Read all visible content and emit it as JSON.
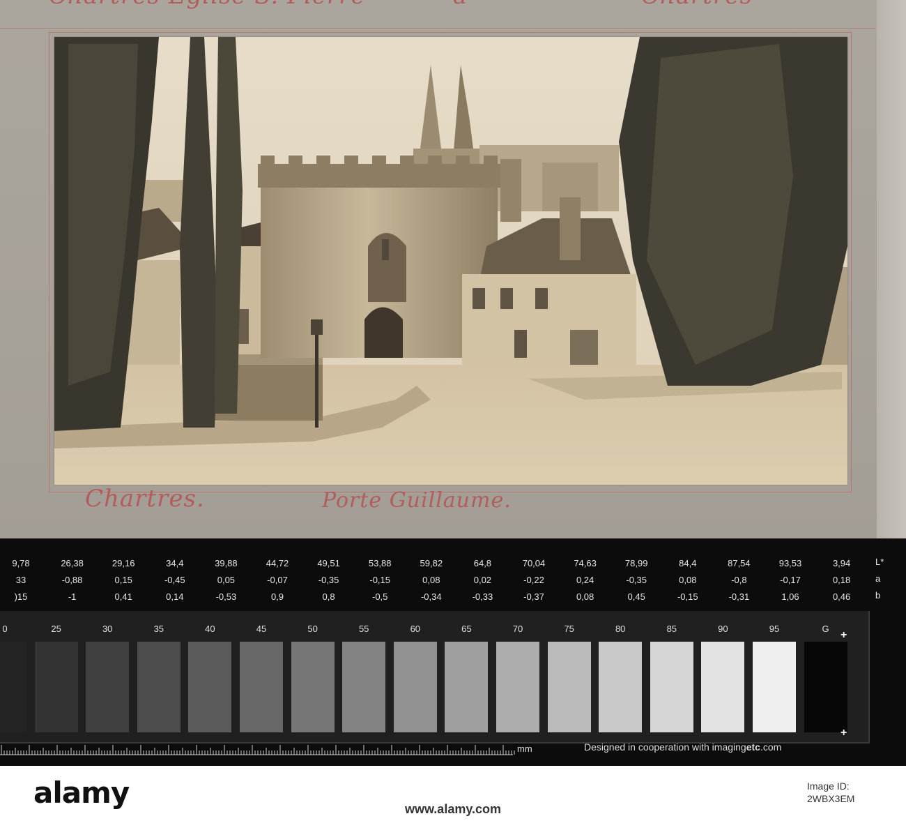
{
  "album": {
    "top_script": [
      "Chartres Église S. Pierre",
      "à",
      "Chartres"
    ],
    "caption_city": "Chartres.",
    "caption_title": "Porte Guillaume."
  },
  "photo": {
    "subject": "Porte Guillaume, Chartres",
    "tone_colors": {
      "sky": "#e7dcc6",
      "stone": "#c3b395",
      "shadow": "#4e4437",
      "foliage": "#3c3a30"
    }
  },
  "target": {
    "lab": {
      "keys": [
        "L*",
        "a",
        "b"
      ],
      "columns": [
        {
          "L": "9,78",
          "a": "33",
          "b": ")15"
        },
        {
          "L": "26,38",
          "a": "-0,88",
          "b": "-1"
        },
        {
          "L": "29,16",
          "a": "0,15",
          "b": "0,41"
        },
        {
          "L": "34,4",
          "a": "-0,45",
          "b": "0,14"
        },
        {
          "L": "39,88",
          "a": "0,05",
          "b": "-0,53"
        },
        {
          "L": "44,72",
          "a": "-0,07",
          "b": "0,9"
        },
        {
          "L": "49,51",
          "a": "-0,35",
          "b": "0,8"
        },
        {
          "L": "53,88",
          "a": "-0,15",
          "b": "-0,5"
        },
        {
          "L": "59,82",
          "a": "0,08",
          "b": "-0,34"
        },
        {
          "L": "64,8",
          "a": "0,02",
          "b": "-0,33"
        },
        {
          "L": "70,04",
          "a": "-0,22",
          "b": "-0,37"
        },
        {
          "L": "74,63",
          "a": "0,24",
          "b": "0,08"
        },
        {
          "L": "78,99",
          "a": "-0,35",
          "b": "0,45"
        },
        {
          "L": "84,4",
          "a": "0,08",
          "b": "-0,15"
        },
        {
          "L": "87,54",
          "a": "-0,8",
          "b": "-0,31"
        },
        {
          "L": "93,53",
          "a": "-0,17",
          "b": "1,06"
        },
        {
          "L": "3,94",
          "a": "0,18",
          "b": "0,46"
        }
      ]
    },
    "patches": [
      {
        "label": "0",
        "color": "#232323"
      },
      {
        "label": "25",
        "color": "#333333"
      },
      {
        "label": "30",
        "color": "#404040"
      },
      {
        "label": "35",
        "color": "#4d4d4d"
      },
      {
        "label": "40",
        "color": "#5a5a5a"
      },
      {
        "label": "45",
        "color": "#686868"
      },
      {
        "label": "50",
        "color": "#767676"
      },
      {
        "label": "55",
        "color": "#838383"
      },
      {
        "label": "60",
        "color": "#919191"
      },
      {
        "label": "65",
        "color": "#9f9f9f"
      },
      {
        "label": "70",
        "color": "#adadad"
      },
      {
        "label": "75",
        "color": "#bbbbbb"
      },
      {
        "label": "80",
        "color": "#c9c9c9"
      },
      {
        "label": "85",
        "color": "#d6d6d6"
      },
      {
        "label": "90",
        "color": "#e3e3e3"
      },
      {
        "label": "95",
        "color": "#efefef"
      },
      {
        "label": "G",
        "color": "#070707"
      }
    ],
    "mm_label": "mm",
    "credit_prefix": "Designed in cooperation with imaging",
    "credit_brand": "etc",
    "credit_suffix": ".com"
  },
  "watermark": {
    "logo": "alamy",
    "url": "www.alamy.com",
    "id_label": "Image ID:",
    "id_value": "2WBX3EM"
  }
}
